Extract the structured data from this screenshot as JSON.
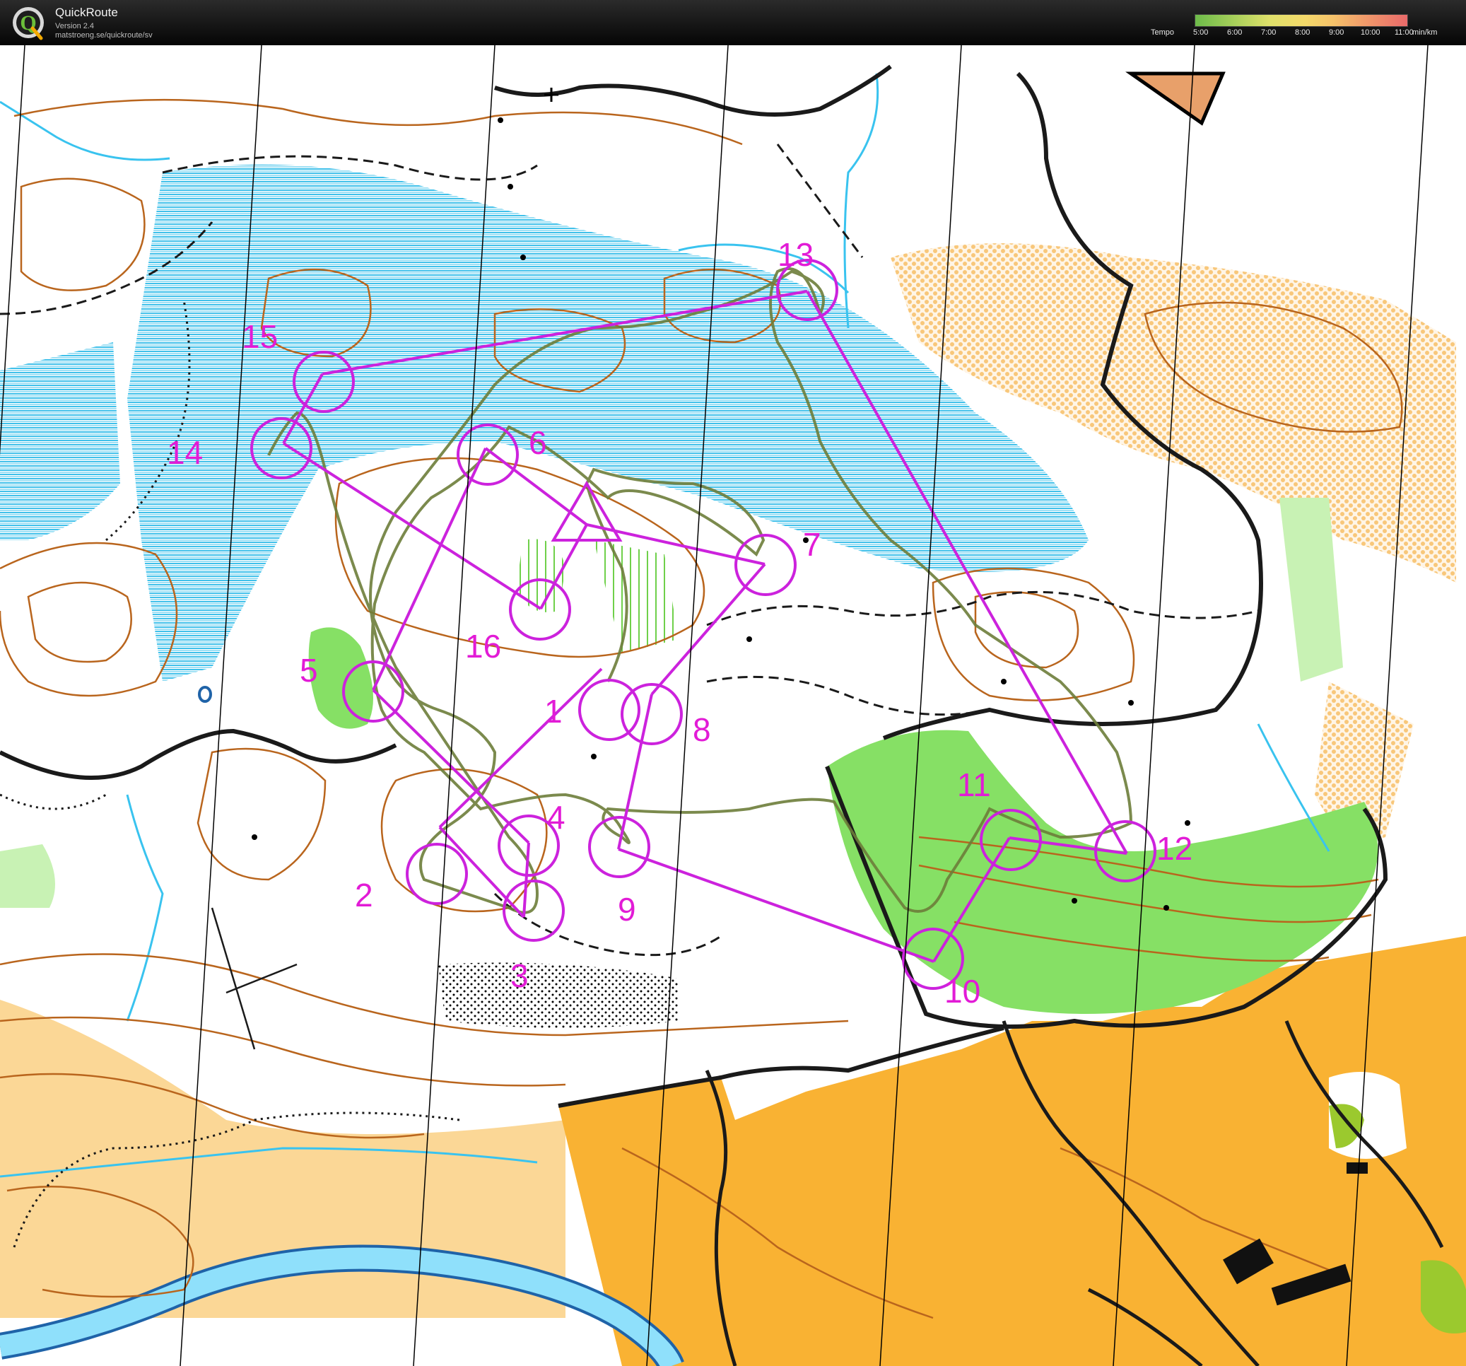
{
  "app": {
    "name": "QuickRoute",
    "version": "Version 2.4",
    "url": "matstroeng.se/quickroute/sv",
    "logo_letter": "Q"
  },
  "tempo": {
    "label": "Tempo",
    "ticks": [
      "5:00",
      "6:00",
      "7:00",
      "8:00",
      "9:00",
      "10:00",
      "11:00"
    ],
    "unit": "min/km",
    "gradient_colors": [
      "#6dbb4a",
      "#dfe06a",
      "#f5c26a",
      "#e96a6a"
    ]
  },
  "course": {
    "color": "#cc22dd",
    "control_labels": [
      "1",
      "2",
      "3",
      "4",
      "5",
      "6",
      "7",
      "8",
      "9",
      "10",
      "11",
      "12",
      "13",
      "14",
      "15",
      "16"
    ]
  },
  "colors": {
    "contour": "#b9651d",
    "water": "#39c3ef",
    "marsh": "#2ca6dc",
    "open_land": "#f9b233",
    "rough_open": "#fbd796",
    "green_vegetation": "#7ed957",
    "route_line": "#6d7d3a"
  }
}
